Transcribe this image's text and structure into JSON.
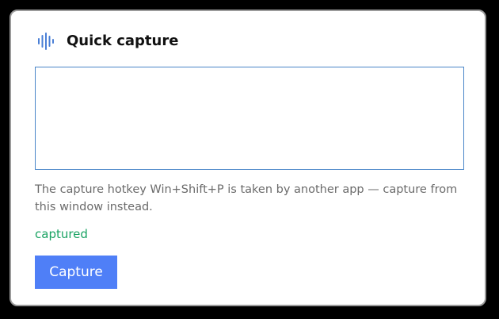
{
  "header": {
    "icon": "audio-waveform-icon",
    "title": "Quick capture"
  },
  "capture_input": {
    "value": "",
    "placeholder": ""
  },
  "message": "The capture hotkey Win+Shift+P is taken by another app — capture from this window instead.",
  "status": "captured",
  "capture_button": {
    "label": "Capture"
  },
  "colors": {
    "accent": "#4f7ff7",
    "icon": "#4a7fd6",
    "status": "#1aa363",
    "input_border": "#4a86c8"
  }
}
